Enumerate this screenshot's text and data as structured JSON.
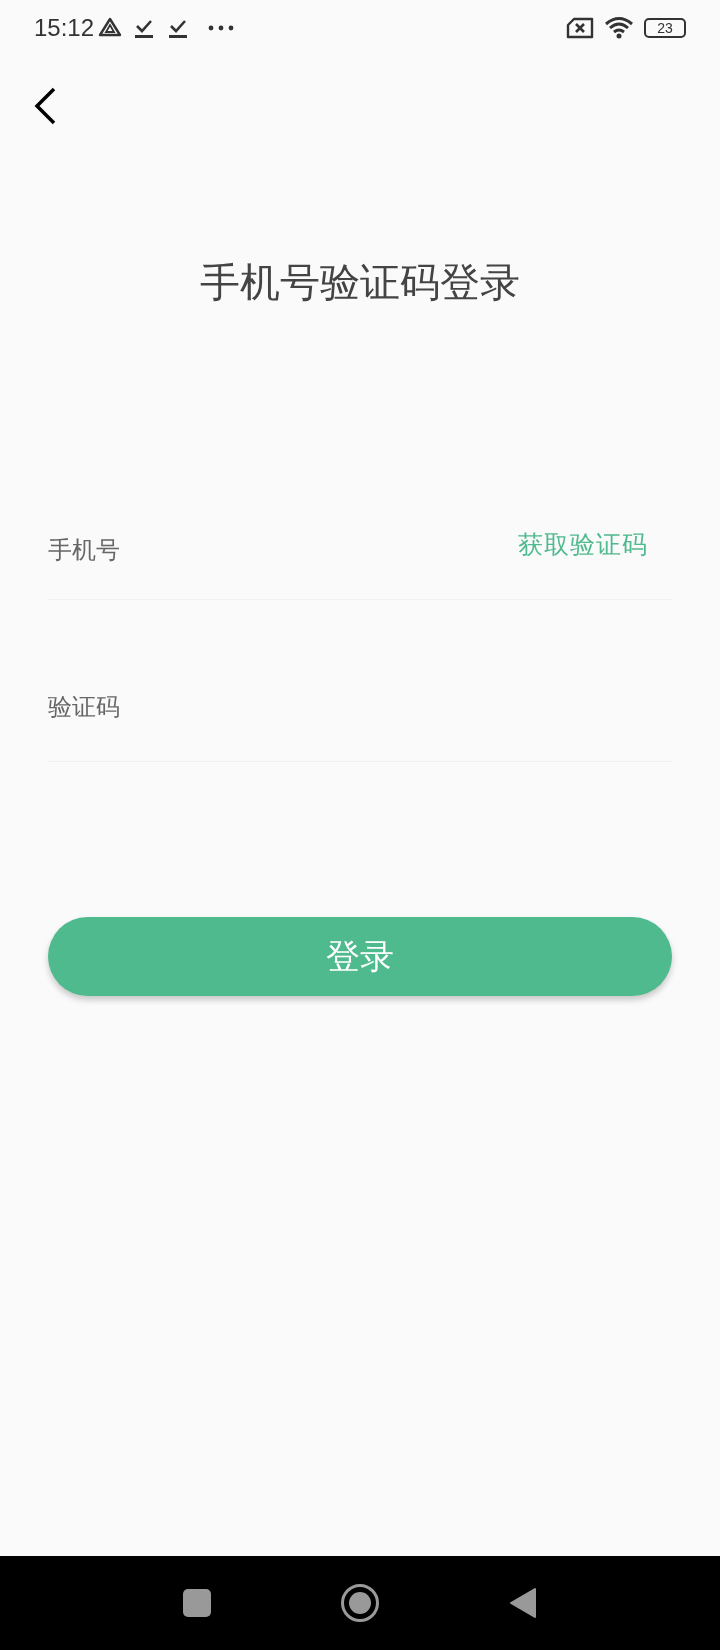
{
  "status_bar": {
    "time": "15:12",
    "battery": "23"
  },
  "title": "手机号验证码登录",
  "phone_field": {
    "placeholder": "手机号"
  },
  "get_code_button": "获取验证码",
  "code_field": {
    "placeholder": "验证码"
  },
  "login_button": "登录"
}
